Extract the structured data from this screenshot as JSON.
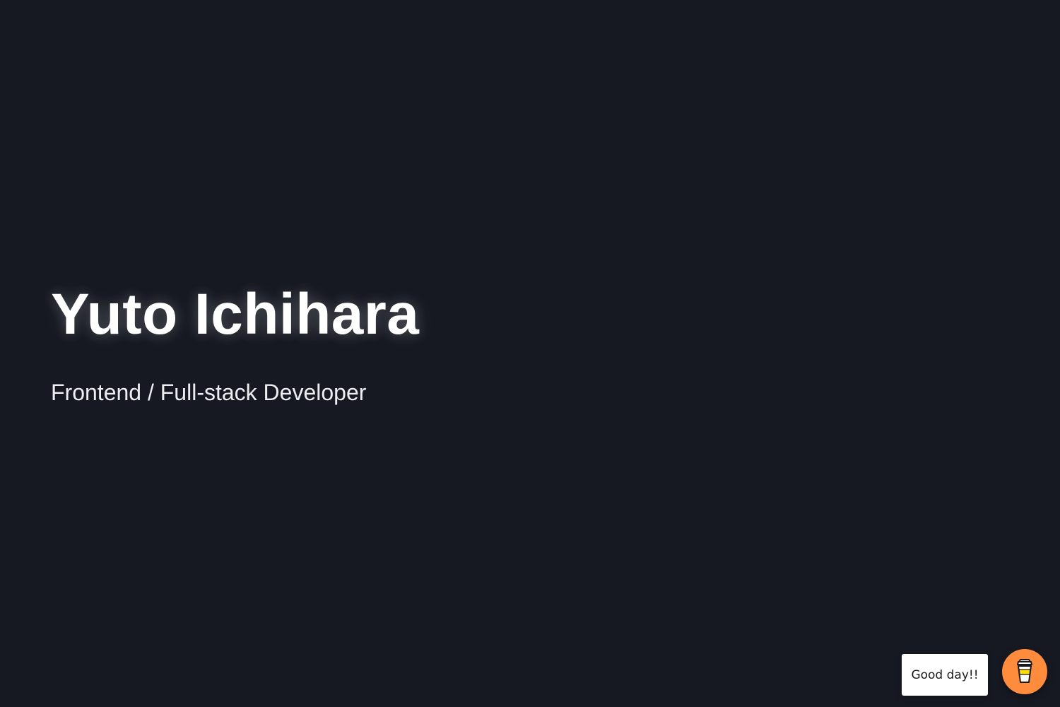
{
  "hero": {
    "name": "Yuto Ichihara",
    "role": "Frontend / Full-stack Developer"
  },
  "widget": {
    "greeting": "Good day!!",
    "button_icon": "coffee-cup-icon"
  },
  "colors": {
    "background": "#171922",
    "title": "#ffffff",
    "subtitle": "#eceef2",
    "accent": "#ff8b3d"
  }
}
